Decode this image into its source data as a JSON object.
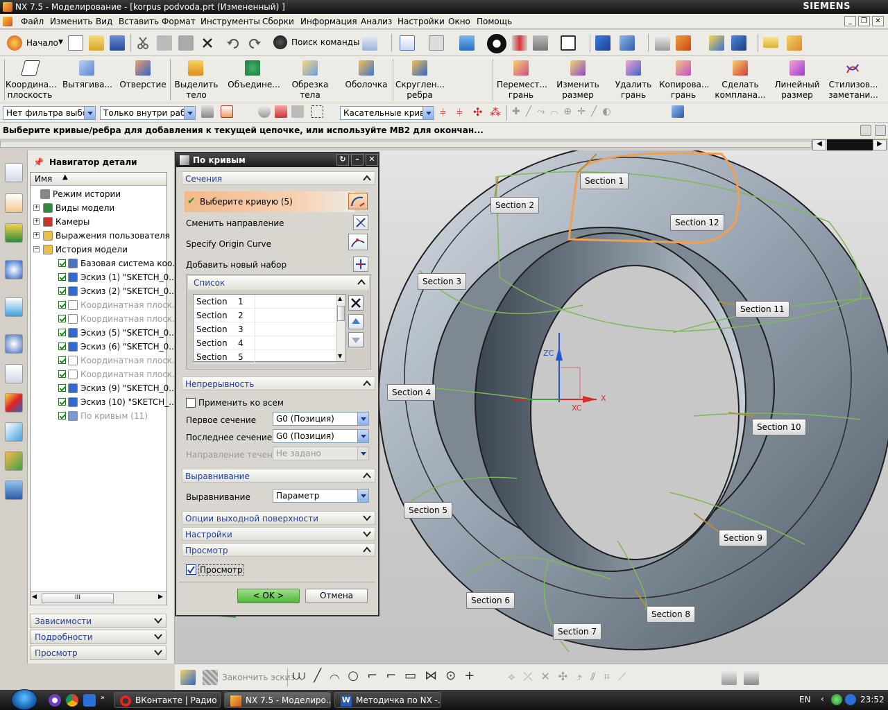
{
  "window": {
    "title": "NX 7.5 - Моделирование - [korpus podvoda.prt (Измененный) ]",
    "brand": "SIEMENS"
  },
  "menu": [
    "Файл",
    "Изменить",
    "Вид",
    "Вставить",
    "Формат",
    "Инструменты",
    "Сборки",
    "Информация",
    "Анализ",
    "Настройки",
    "Окно",
    "Помощь"
  ],
  "toolbar1": {
    "start_label": "Начало",
    "search_label": "Поиск команды"
  },
  "toolbar2": [
    {
      "l1": "Координа...",
      "l2": "плоскость"
    },
    {
      "l1": "Вытягива...",
      "l2": ""
    },
    {
      "l1": "Отверстие",
      "l2": ""
    },
    {
      "l1": "Выделить",
      "l2": "тело"
    },
    {
      "l1": "Объедине...",
      "l2": ""
    },
    {
      "l1": "Обрезка",
      "l2": "тела"
    },
    {
      "l1": "Оболочка",
      "l2": ""
    },
    {
      "l1": "Скруглен...",
      "l2": "ребра"
    },
    {
      "l1": "Перемест...",
      "l2": "грань"
    },
    {
      "l1": "Изменить",
      "l2": "размер"
    },
    {
      "l1": "Удалить",
      "l2": "грань"
    },
    {
      "l1": "Копирова...",
      "l2": "грань"
    },
    {
      "l1": "Сделать",
      "l2": "комплана..."
    },
    {
      "l1": "Линейный",
      "l2": "размер"
    },
    {
      "l1": "Стилизов...",
      "l2": "заметани..."
    }
  ],
  "filters": {
    "type_filter": "Нет фильтра выбор",
    "scope_filter": "Только внутри рабо",
    "curve_rule": "Касательные кривые"
  },
  "status_message": "Выберите кривые/ребра для добавления к текущей цепочке, или используйте MB2 для окончан...",
  "navigator": {
    "title": "Навигатор детали",
    "column": "Имя",
    "rows": [
      {
        "label": "Режим истории",
        "grey": false
      },
      {
        "label": "Виды модели",
        "grey": false
      },
      {
        "label": "Камеры",
        "grey": false
      },
      {
        "label": "Выражения пользователя",
        "grey": false
      },
      {
        "label": "История модели",
        "grey": false
      },
      {
        "label": "Базовая система коо...",
        "grey": false
      },
      {
        "label": "Эскиз (1) \"SKETCH_0...",
        "grey": false
      },
      {
        "label": "Эскиз (2) \"SKETCH_0...",
        "grey": false
      },
      {
        "label": "Координатная плоск...",
        "grey": true
      },
      {
        "label": "Координатная плоск...",
        "grey": true
      },
      {
        "label": "Эскиз (5) \"SKETCH_0...",
        "grey": false
      },
      {
        "label": "Эскиз (6) \"SKETCH_0...",
        "grey": false
      },
      {
        "label": "Координатная плоск...",
        "grey": true
      },
      {
        "label": "Координатная плоск...",
        "grey": true
      },
      {
        "label": "Эскиз (9) \"SKETCH_0...",
        "grey": false
      },
      {
        "label": "Эскиз (10) \"SKETCH_...",
        "grey": false
      },
      {
        "label": "По кривым (11)",
        "grey": true
      }
    ],
    "hscroll": "III",
    "panels": [
      "Зависимости",
      "Подробности",
      "Просмотр"
    ]
  },
  "dialog": {
    "title": "По кривым",
    "sections_header": "Сечения",
    "select_curve": "Выберите кривую (5)",
    "reverse": "Сменить направление",
    "origin": "Specify Origin Curve",
    "add_set": "Добавить новый набор",
    "list_header": "Список",
    "list": [
      {
        "a": "Section",
        "b": "1"
      },
      {
        "a": "Section",
        "b": "2"
      },
      {
        "a": "Section",
        "b": "3"
      },
      {
        "a": "Section",
        "b": "4"
      },
      {
        "a": "Section",
        "b": "5"
      }
    ],
    "continuity_header": "Непрерывность",
    "apply_all": "Применить ко всем",
    "first_label": "Первое сечение",
    "first_value": "G0 (Позиция)",
    "last_label": "Последнее сечение",
    "last_value": "G0 (Позиция)",
    "flow_label": "Направление течения",
    "flow_value": "Не задано",
    "alignment_header": "Выравнивание",
    "alignment_label": "Выравнивание",
    "alignment_value": "Параметр",
    "output_header": "Опции выходной поверхности",
    "settings_header": "Настройки",
    "preview_header": "Просмотр",
    "preview_check": "Просмотр",
    "ok": "< OK >",
    "cancel": "Отмена"
  },
  "viewport": {
    "sections": [
      "Section 1",
      "Section 2",
      "Section 12",
      "Section 3",
      "Section 11",
      "Section 4",
      "Section 10",
      "Section 5",
      "Section 9",
      "Section 6",
      "Section 8",
      "Section 7"
    ],
    "axes": {
      "zc": "ZC",
      "xc": "XC",
      "x": "X"
    }
  },
  "bottom_toolbar": {
    "finish_sketch": "Закончить эскиз"
  },
  "taskbar": {
    "tasks": [
      "ВКонтакте | Радио -...",
      "NX 7.5 - Моделиро...",
      "Методичка по NX -..."
    ],
    "lang": "EN",
    "time": "23:52"
  }
}
